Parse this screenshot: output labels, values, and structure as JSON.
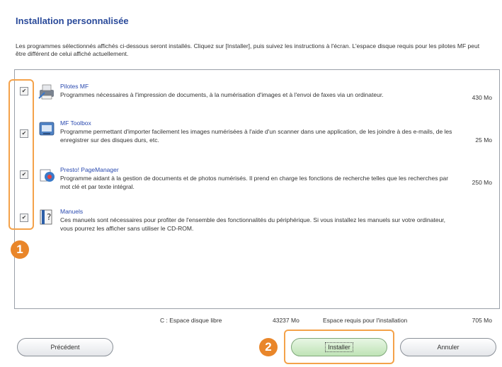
{
  "dialog": {
    "title": "Installation personnalisée",
    "intro": "Les programmes sélectionnés affichés ci-dessous seront installés. Cliquez sur [Installer], puis suivez les instructions à l'écran. L'espace disque requis pour les pilotes MF peut être différent de celui affiché actuellement."
  },
  "items": [
    {
      "name": "Pilotes MF",
      "desc": "Programmes nécessaires à l'impression de documents, à la numérisation d'images et à l'envoi de faxes via un ordinateur.",
      "size": "430 Mo",
      "checked": true,
      "icon": "printer-driver-icon"
    },
    {
      "name": "MF Toolbox",
      "desc": "Programme permettant d'importer facilement les images numérisées à l'aide d'un scanner dans une application, de les joindre à des e-mails, de les enregistrer sur des disques durs, etc.",
      "size": "25 Mo",
      "checked": true,
      "icon": "toolbox-icon"
    },
    {
      "name": "Presto! PageManager",
      "desc": "Programme aidant à la gestion de documents et de photos numérisés. Il prend en charge les fonctions de recherche telles que les recherches par mot clé et par texte intégral.",
      "size": "250 Mo",
      "checked": true,
      "icon": "pagemanager-icon"
    },
    {
      "name": "Manuels",
      "desc": "Ces manuels sont nécessaires pour profiter de l'ensemble des fonctionnalités du périphérique. Si vous installez les manuels sur votre ordinateur, vous pourrez les afficher sans utiliser le CD-ROM.",
      "size": "",
      "checked": true,
      "icon": "manuals-icon"
    }
  ],
  "footer": {
    "free_label": "C : Espace disque libre",
    "free_value": "43237 Mo",
    "req_label": "Espace requis pour l'installation",
    "req_value": "705 Mo"
  },
  "buttons": {
    "previous": "Précédent",
    "install": "Installer",
    "cancel": "Annuler"
  },
  "callouts": {
    "one": "1",
    "two": "2"
  },
  "colors": {
    "accent": "#e9862a",
    "title": "#2a4a9a"
  }
}
